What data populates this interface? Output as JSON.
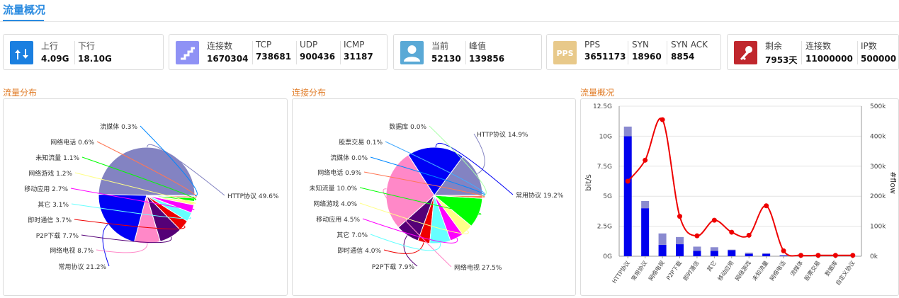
{
  "header": {
    "title": "流量概况"
  },
  "cards": [
    {
      "icon": "up-down-arrows-icon",
      "color": "#1a7fe0",
      "stats": [
        {
          "label": "上行",
          "value": "4.09G"
        },
        {
          "label": "下行",
          "value": "18.10G"
        }
      ]
    },
    {
      "icon": "stairs-icon",
      "color": "#8f92f5",
      "stats": [
        {
          "label": "连接数",
          "value": "1670304"
        },
        {
          "label": "TCP",
          "value": "738681"
        },
        {
          "label": "UDP",
          "value": "900436"
        },
        {
          "label": "ICMP",
          "value": "31187"
        }
      ]
    },
    {
      "icon": "user-icon",
      "color": "#5aa9d6",
      "stats": [
        {
          "label": "当前",
          "value": "52130"
        },
        {
          "label": "峰值",
          "value": "139856"
        }
      ]
    },
    {
      "icon": "pps-icon",
      "icon_text": "PPS",
      "color": "#e8c98a",
      "stats": [
        {
          "label": "PPS",
          "value": "3651173"
        },
        {
          "label": "SYN",
          "value": "18960"
        },
        {
          "label": "SYN ACK",
          "value": "8854"
        }
      ]
    },
    {
      "icon": "key-icon",
      "color": "#c0272d",
      "stats": [
        {
          "label": "剩余",
          "value": "7953天"
        },
        {
          "label": "连接数",
          "value": "11000000"
        },
        {
          "label": "IP数",
          "value": "500000"
        }
      ]
    }
  ],
  "sections": {
    "flow_dist": "流量分布",
    "conn_dist": "连接分布",
    "flow_overview": "流量概况"
  },
  "chart_data": [
    {
      "type": "pie",
      "title": "流量分布",
      "slices": [
        {
          "name": "HTTP协议",
          "value": 49.6,
          "label": "HTTP协议 49.6%",
          "color": "#8383c2"
        },
        {
          "name": "常用协议",
          "value": 21.2,
          "label": "常用协议 21.2%",
          "color": "#0000f5"
        },
        {
          "name": "网络电视",
          "value": 8.7,
          "label": "网络电视 8.7%",
          "color": "#ff88c8"
        },
        {
          "name": "P2P下载",
          "value": 7.7,
          "label": "P2P下载 7.7%",
          "color": "#550077"
        },
        {
          "name": "即时通信",
          "value": 3.7,
          "label": "即时通信 3.7%",
          "color": "#ee0000"
        },
        {
          "name": "其它",
          "value": 3.1,
          "label": "其它 3.1%",
          "color": "#66ffff"
        },
        {
          "name": "移动应用",
          "value": 2.7,
          "label": "移动应用 2.7%",
          "color": "#ff00ff"
        },
        {
          "name": "网络游戏",
          "value": 1.2,
          "label": "网络游戏 1.2%",
          "color": "#ffff88"
        },
        {
          "name": "未知流量",
          "value": 1.1,
          "label": "未知流量 1.1%",
          "color": "#00ff00"
        },
        {
          "name": "网络电话",
          "value": 0.6,
          "label": "网络电话 0.6%",
          "color": "#ff7755"
        },
        {
          "name": "流媒体",
          "value": 0.3,
          "label": "流媒体 0.3%",
          "color": "#0088ff"
        }
      ]
    },
    {
      "type": "pie",
      "title": "连接分布",
      "slices": [
        {
          "name": "HTTP协议",
          "value": 14.9,
          "label": "HTTP协议 14.9%",
          "color": "#8383c2"
        },
        {
          "name": "常用协议",
          "value": 19.2,
          "label": "常用协议 19.2%",
          "color": "#0000f5"
        },
        {
          "name": "网络电视",
          "value": 27.5,
          "label": "网络电视 27.5%",
          "color": "#ff88c8"
        },
        {
          "name": "P2P下载",
          "value": 7.9,
          "label": "P2P下载 7.9%",
          "color": "#550077"
        },
        {
          "name": "即时通信",
          "value": 4.0,
          "label": "即时通信 4.0%",
          "color": "#ee0000"
        },
        {
          "name": "其它",
          "value": 7.0,
          "label": "其它 7.0%",
          "color": "#66ffff"
        },
        {
          "name": "移动应用",
          "value": 4.5,
          "label": "移动应用 4.5%",
          "color": "#ff00ff"
        },
        {
          "name": "网络游戏",
          "value": 4.0,
          "label": "网络游戏 4.0%",
          "color": "#ffff88"
        },
        {
          "name": "未知流量",
          "value": 10.0,
          "label": "未知流量 10.0%",
          "color": "#00ff00"
        },
        {
          "name": "网络电话",
          "value": 0.9,
          "label": "网络电话 0.9%",
          "color": "#ff7755"
        },
        {
          "name": "流媒体",
          "value": 0.0,
          "label": "流媒体 0.0%",
          "color": "#0088ff"
        },
        {
          "name": "股票交易",
          "value": 0.1,
          "label": "股票交易 0.1%",
          "color": "#44aaff"
        },
        {
          "name": "数据库",
          "value": 0.0,
          "label": "数据库 0.0%",
          "color": "#aaffaa"
        }
      ]
    },
    {
      "type": "bar",
      "title": "流量概况",
      "categories": [
        "HTTP协议",
        "常用协议",
        "网络电视",
        "P2P下载",
        "即时通信",
        "其它",
        "移动应用",
        "网络游戏",
        "未知流量",
        "网络电话",
        "流媒体",
        "股票交易",
        "数据库",
        "自定义协议"
      ],
      "series": [
        {
          "values": [
            10.0,
            4.0,
            0.95,
            1.0,
            0.45,
            0.45,
            0.5,
            0.2,
            0.2,
            0.05,
            0.02,
            0.01,
            0.01,
            0.01
          ],
          "color": "#0000ee",
          "axis": "left"
        },
        {
          "values": [
            0.8,
            0.6,
            0.95,
            0.6,
            0.35,
            0.3,
            0.05,
            0.1,
            0.05,
            0.05,
            0.01,
            0.01,
            0.01,
            0.01
          ],
          "color": "#8a8ad0",
          "axis": "left",
          "stacked": true
        },
        {
          "type": "line",
          "values": [
            250000,
            320000,
            455000,
            133000,
            68000,
            120000,
            80000,
            70000,
            168000,
            18000,
            3000,
            3000,
            3000,
            3000
          ],
          "color": "#ee0000",
          "axis": "right"
        }
      ],
      "ylabel": "bit/s",
      "y2label": "#flow",
      "ylim": [
        0,
        12.5
      ],
      "y2lim": [
        0,
        500000
      ],
      "yticks": [
        "0G",
        "2.5G",
        "5G",
        "7.5G",
        "10G",
        "12.5G"
      ],
      "y2ticks": [
        "0k",
        "100k",
        "200k",
        "300k",
        "400k",
        "500k"
      ],
      "grid": true
    }
  ]
}
